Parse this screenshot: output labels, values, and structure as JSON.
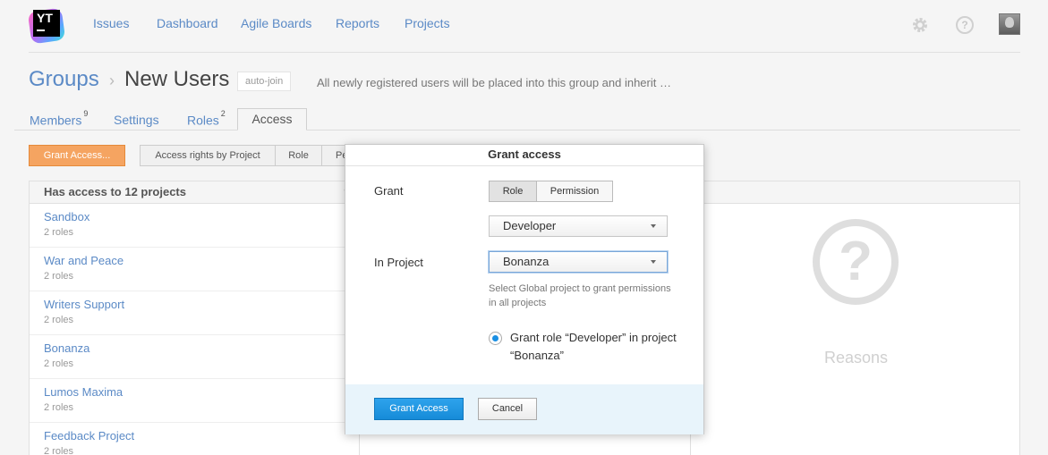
{
  "header": {
    "logo_text": "YT",
    "nav": [
      "Issues",
      "Dashboard",
      "Agile Boards",
      "Reports",
      "Projects"
    ],
    "help_glyph": "?"
  },
  "breadcrumb": {
    "root": "Groups",
    "separator": "›",
    "title": "New Users",
    "badge": "auto-join",
    "description": "All newly registered users will be placed into this group and inherit …"
  },
  "tabs": {
    "members": "Members",
    "members_count": "9",
    "settings": "Settings",
    "roles": "Roles",
    "roles_count": "2",
    "access": "Access"
  },
  "toolbar": {
    "grant_button": "Grant Access...",
    "views": [
      "Access rights by Project",
      "Role",
      "Pe"
    ]
  },
  "left_panel": {
    "header": "Has access to 12 projects",
    "projects": [
      {
        "name": "Sandbox",
        "roles": "2 roles"
      },
      {
        "name": "War and Peace",
        "roles": "2 roles"
      },
      {
        "name": "Writers Support",
        "roles": "2 roles"
      },
      {
        "name": "Bonanza",
        "roles": "2 roles"
      },
      {
        "name": "Lumos Maxima",
        "roles": "2 roles"
      },
      {
        "name": "Feedback Project",
        "roles": "2 roles"
      }
    ]
  },
  "right_panel": {
    "placeholder_glyph": "?",
    "title": "Reasons"
  },
  "dialog": {
    "title": "Grant access",
    "grant_label": "Grant",
    "toggle_role": "Role",
    "toggle_permission": "Permission",
    "role_value": "Developer",
    "project_label": "In Project",
    "project_value": "Bonanza",
    "hint": "Select Global project to grant permissions in all projects",
    "radio_label": "Grant role “Developer” in project “Bonanza”",
    "primary_button": "Grant Access",
    "cancel_button": "Cancel"
  },
  "icons": {
    "logo": "youtrack-logo-icon",
    "settings": "gear-icon",
    "help": "help-icon",
    "user": "avatar",
    "search": "search-icon",
    "reasons": "question-icon"
  },
  "colors": {
    "link": "#5b8ac6",
    "grant_button": "#f5a461",
    "primary_button": "#168bd8",
    "dialog_footer": "#e8f4fb"
  }
}
